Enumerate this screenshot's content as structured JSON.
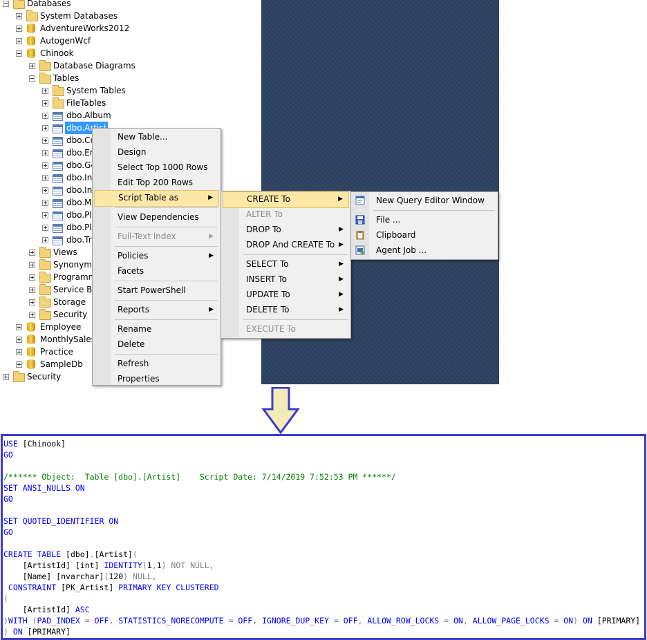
{
  "tree": {
    "nodes": [
      {
        "label": "Databases",
        "icon": "folder-icon",
        "expander": "minus",
        "level": 0
      },
      {
        "label": "System Databases",
        "icon": "folder-icon",
        "expander": "plus",
        "level": 1
      },
      {
        "label": "AdventureWorks2012",
        "icon": "database-icon",
        "expander": "plus",
        "level": 1
      },
      {
        "label": "AutogenWcf",
        "icon": "database-icon",
        "expander": "plus",
        "level": 1
      },
      {
        "label": "Chinook",
        "icon": "database-icon",
        "expander": "minus",
        "level": 1
      },
      {
        "label": "Database Diagrams",
        "icon": "folder-icon",
        "expander": "plus",
        "level": 2
      },
      {
        "label": "Tables",
        "icon": "folder-icon",
        "expander": "minus",
        "level": 2
      },
      {
        "label": "System Tables",
        "icon": "folder-icon",
        "expander": "plus",
        "level": 3
      },
      {
        "label": "FileTables",
        "icon": "folder-icon",
        "expander": "plus",
        "level": 3
      },
      {
        "label": "dbo.Album",
        "icon": "table-icon",
        "expander": "plus",
        "level": 3
      },
      {
        "label": "dbo.Artist",
        "icon": "table-icon",
        "expander": "plus",
        "level": 3,
        "selected": true
      },
      {
        "label": "dbo.Cu",
        "icon": "table-icon",
        "expander": "plus",
        "level": 3
      },
      {
        "label": "dbo.Em",
        "icon": "table-icon",
        "expander": "plus",
        "level": 3
      },
      {
        "label": "dbo.Ge",
        "icon": "table-icon",
        "expander": "plus",
        "level": 3
      },
      {
        "label": "dbo.Inv",
        "icon": "table-icon",
        "expander": "plus",
        "level": 3
      },
      {
        "label": "dbo.Inv",
        "icon": "table-icon",
        "expander": "plus",
        "level": 3
      },
      {
        "label": "dbo.Me",
        "icon": "table-icon",
        "expander": "plus",
        "level": 3
      },
      {
        "label": "dbo.Pla",
        "icon": "table-icon",
        "expander": "plus",
        "level": 3
      },
      {
        "label": "dbo.Pla",
        "icon": "table-icon",
        "expander": "plus",
        "level": 3
      },
      {
        "label": "dbo.Tra",
        "icon": "table-icon",
        "expander": "plus",
        "level": 3
      },
      {
        "label": "Views",
        "icon": "folder-icon",
        "expander": "plus",
        "level": 2
      },
      {
        "label": "Synonyms",
        "icon": "folder-icon",
        "expander": "plus",
        "level": 2
      },
      {
        "label": "Programm",
        "icon": "folder-icon",
        "expander": "plus",
        "level": 2
      },
      {
        "label": "Service Bro",
        "icon": "folder-icon",
        "expander": "plus",
        "level": 2
      },
      {
        "label": "Storage",
        "icon": "folder-icon",
        "expander": "plus",
        "level": 2
      },
      {
        "label": "Security",
        "icon": "folder-icon",
        "expander": "plus",
        "level": 2
      },
      {
        "label": "Employee",
        "icon": "database-icon",
        "expander": "plus",
        "level": 1
      },
      {
        "label": "MonthlySales",
        "icon": "database-icon",
        "expander": "plus",
        "level": 1
      },
      {
        "label": "Practice",
        "icon": "database-icon",
        "expander": "plus",
        "level": 1
      },
      {
        "label": "SampleDb",
        "icon": "database-icon",
        "expander": "plus",
        "level": 1
      },
      {
        "label": "Security",
        "icon": "folder-icon",
        "expander": "plus",
        "level": 0
      }
    ]
  },
  "context_menu": {
    "items": [
      {
        "label": "New Table...",
        "name": "menu-new-table"
      },
      {
        "label": "Design",
        "name": "menu-design"
      },
      {
        "label": "Select Top 1000 Rows",
        "name": "menu-select-top-1000"
      },
      {
        "label": "Edit Top 200 Rows",
        "name": "menu-edit-top-200"
      },
      {
        "label": "Script Table as",
        "name": "menu-script-table-as",
        "submenu": true,
        "highlighted": true
      },
      {
        "sep": true
      },
      {
        "label": "View Dependencies",
        "name": "menu-view-dependencies"
      },
      {
        "sep": true
      },
      {
        "label": "Full-Text index",
        "name": "menu-full-text-index",
        "submenu": true,
        "disabled": true
      },
      {
        "sep": true
      },
      {
        "label": "Policies",
        "name": "menu-policies",
        "submenu": true
      },
      {
        "label": "Facets",
        "name": "menu-facets"
      },
      {
        "sep": true
      },
      {
        "label": "Start PowerShell",
        "name": "menu-start-powershell"
      },
      {
        "sep": true
      },
      {
        "label": "Reports",
        "name": "menu-reports",
        "submenu": true
      },
      {
        "sep": true
      },
      {
        "label": "Rename",
        "name": "menu-rename"
      },
      {
        "label": "Delete",
        "name": "menu-delete"
      },
      {
        "sep": true
      },
      {
        "label": "Refresh",
        "name": "menu-refresh"
      },
      {
        "label": "Properties",
        "name": "menu-properties"
      }
    ]
  },
  "script_menu": {
    "items": [
      {
        "label": "CREATE To",
        "name": "menu-create-to",
        "submenu": true,
        "highlighted": true
      },
      {
        "label": "ALTER To",
        "name": "menu-alter-to",
        "disabled": true
      },
      {
        "label": "DROP To",
        "name": "menu-drop-to",
        "submenu": true
      },
      {
        "label": "DROP And CREATE To",
        "name": "menu-drop-and-create-to",
        "submenu": true
      },
      {
        "sep": true
      },
      {
        "label": "SELECT To",
        "name": "menu-select-to",
        "submenu": true
      },
      {
        "label": "INSERT To",
        "name": "menu-insert-to",
        "submenu": true
      },
      {
        "label": "UPDATE To",
        "name": "menu-update-to",
        "submenu": true
      },
      {
        "label": "DELETE To",
        "name": "menu-delete-to",
        "submenu": true
      },
      {
        "sep": true
      },
      {
        "label": "EXECUTE To",
        "name": "menu-execute-to",
        "disabled": true
      }
    ]
  },
  "create_menu": {
    "items": [
      {
        "label": "New Query Editor Window",
        "name": "menu-new-query-editor-window",
        "icon": "query-window-icon"
      },
      {
        "sep": true
      },
      {
        "label": "File ...",
        "name": "menu-file",
        "icon": "save-icon"
      },
      {
        "label": "Clipboard",
        "name": "menu-clipboard",
        "icon": "clipboard-icon"
      },
      {
        "label": "Agent Job ...",
        "name": "menu-agent-job",
        "icon": "agent-job-icon"
      }
    ]
  },
  "code": {
    "lines": [
      [
        [
          "kw",
          "USE "
        ],
        [
          "tx",
          "[Chinook]"
        ]
      ],
      [
        [
          "kw",
          "GO"
        ]
      ],
      [],
      [
        [
          "cm",
          "/****** Object:  Table [dbo].[Artist]    Script Date: 7/14/2019 7:52:53 PM ******/"
        ]
      ],
      [
        [
          "kw",
          "SET ANSI_NULLS ON"
        ]
      ],
      [
        [
          "kw",
          "GO"
        ]
      ],
      [],
      [
        [
          "kw",
          "SET QUOTED_IDENTIFIER ON"
        ]
      ],
      [
        [
          "kw",
          "GO"
        ]
      ],
      [],
      [
        [
          "kw",
          "CREATE TABLE "
        ],
        [
          "tx",
          "[dbo]"
        ],
        [
          "gr",
          "."
        ],
        [
          "tx",
          "[Artist]"
        ],
        [
          "gr",
          "("
        ]
      ],
      [
        [
          "tx",
          "    [ArtistId] [int] "
        ],
        [
          "kw",
          "IDENTITY"
        ],
        [
          "gr",
          "("
        ],
        [
          "tx",
          "1"
        ],
        [
          "gr",
          ","
        ],
        [
          "tx",
          "1"
        ],
        [
          "gr",
          ") NOT NULL,"
        ]
      ],
      [
        [
          "tx",
          "    [Name] [nvarchar]"
        ],
        [
          "gr",
          "("
        ],
        [
          "tx",
          "120"
        ],
        [
          "gr",
          ") NULL,"
        ]
      ],
      [
        [
          "kw",
          " CONSTRAINT "
        ],
        [
          "tx",
          "[PK_Artist] "
        ],
        [
          "kw",
          "PRIMARY KEY CLUSTERED"
        ]
      ],
      [
        [
          "gr",
          "("
        ]
      ],
      [
        [
          "tx",
          "    [ArtistId] "
        ],
        [
          "kw",
          "ASC"
        ]
      ],
      [
        [
          "gr",
          ")"
        ],
        [
          "kw",
          "WITH "
        ],
        [
          "gr",
          "("
        ],
        [
          "kw",
          "PAD_INDEX "
        ],
        [
          "gr",
          "= "
        ],
        [
          "kw",
          "OFF"
        ],
        [
          "gr",
          ", "
        ],
        [
          "kw",
          "STATISTICS_NORECOMPUTE "
        ],
        [
          "gr",
          "= "
        ],
        [
          "kw",
          "OFF"
        ],
        [
          "gr",
          ", "
        ],
        [
          "kw",
          "IGNORE_DUP_KEY "
        ],
        [
          "gr",
          "= "
        ],
        [
          "kw",
          "OFF"
        ],
        [
          "gr",
          ", "
        ],
        [
          "kw",
          "ALLOW_ROW_LOCKS "
        ],
        [
          "gr",
          "= "
        ],
        [
          "kw",
          "ON"
        ],
        [
          "gr",
          ", "
        ],
        [
          "kw",
          "ALLOW_PAGE_LOCKS "
        ],
        [
          "gr",
          "= "
        ],
        [
          "kw",
          "ON"
        ],
        [
          "gr",
          ") "
        ],
        [
          "kw",
          "ON "
        ],
        [
          "tx",
          "[PRIMARY]"
        ]
      ],
      [
        [
          "gr",
          ") "
        ],
        [
          "kw",
          "ON "
        ],
        [
          "tx",
          "[PRIMARY]"
        ]
      ]
    ]
  }
}
